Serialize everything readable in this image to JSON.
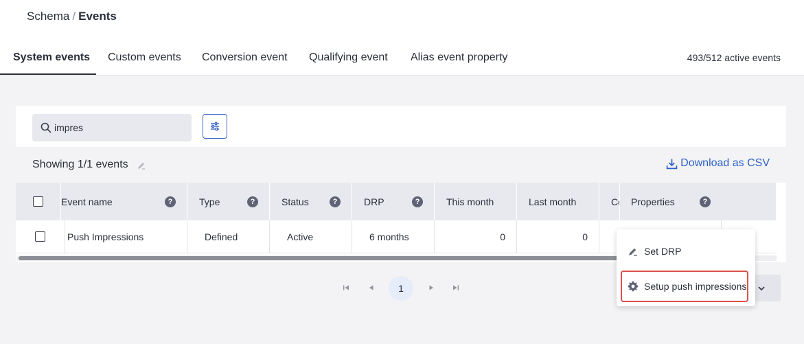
{
  "breadcrumb": {
    "parent": "Schema",
    "separator": "/",
    "current": "Events"
  },
  "tabs": [
    {
      "label": "System events",
      "active": true
    },
    {
      "label": "Custom events",
      "active": false
    },
    {
      "label": "Conversion event",
      "active": false
    },
    {
      "label": "Qualifying event",
      "active": false
    },
    {
      "label": "Alias event property",
      "active": false
    }
  ],
  "active_events": "493/512 active events",
  "search": {
    "value": "impres",
    "icon": "search-icon"
  },
  "filter_icon": "sliders-icon",
  "showing_text": "Showing 1/1 events",
  "download_label": "Download as CSV",
  "table": {
    "headers": {
      "event_name": "Event name",
      "type": "Type",
      "status": "Status",
      "drp": "DRP",
      "this_month": "This month",
      "last_month": "Last month",
      "co": "Co",
      "properties": "Properties"
    },
    "help_glyph": "?",
    "rows": [
      {
        "event_name": "Push Impressions",
        "type": "Defined",
        "status": "Active",
        "drp": "6 months",
        "this_month": "0",
        "last_month": "0"
      }
    ]
  },
  "pagination": {
    "current_page": "1"
  },
  "context_menu": {
    "items": [
      {
        "label": "Set DRP",
        "icon": "pen-icon"
      },
      {
        "label": "Setup push impressions",
        "icon": "gear-icon",
        "highlighted": true
      }
    ]
  },
  "colors": {
    "accent": "#2d5fc8",
    "highlight_border": "#d9524a",
    "header_bg": "#e8e9ee"
  }
}
